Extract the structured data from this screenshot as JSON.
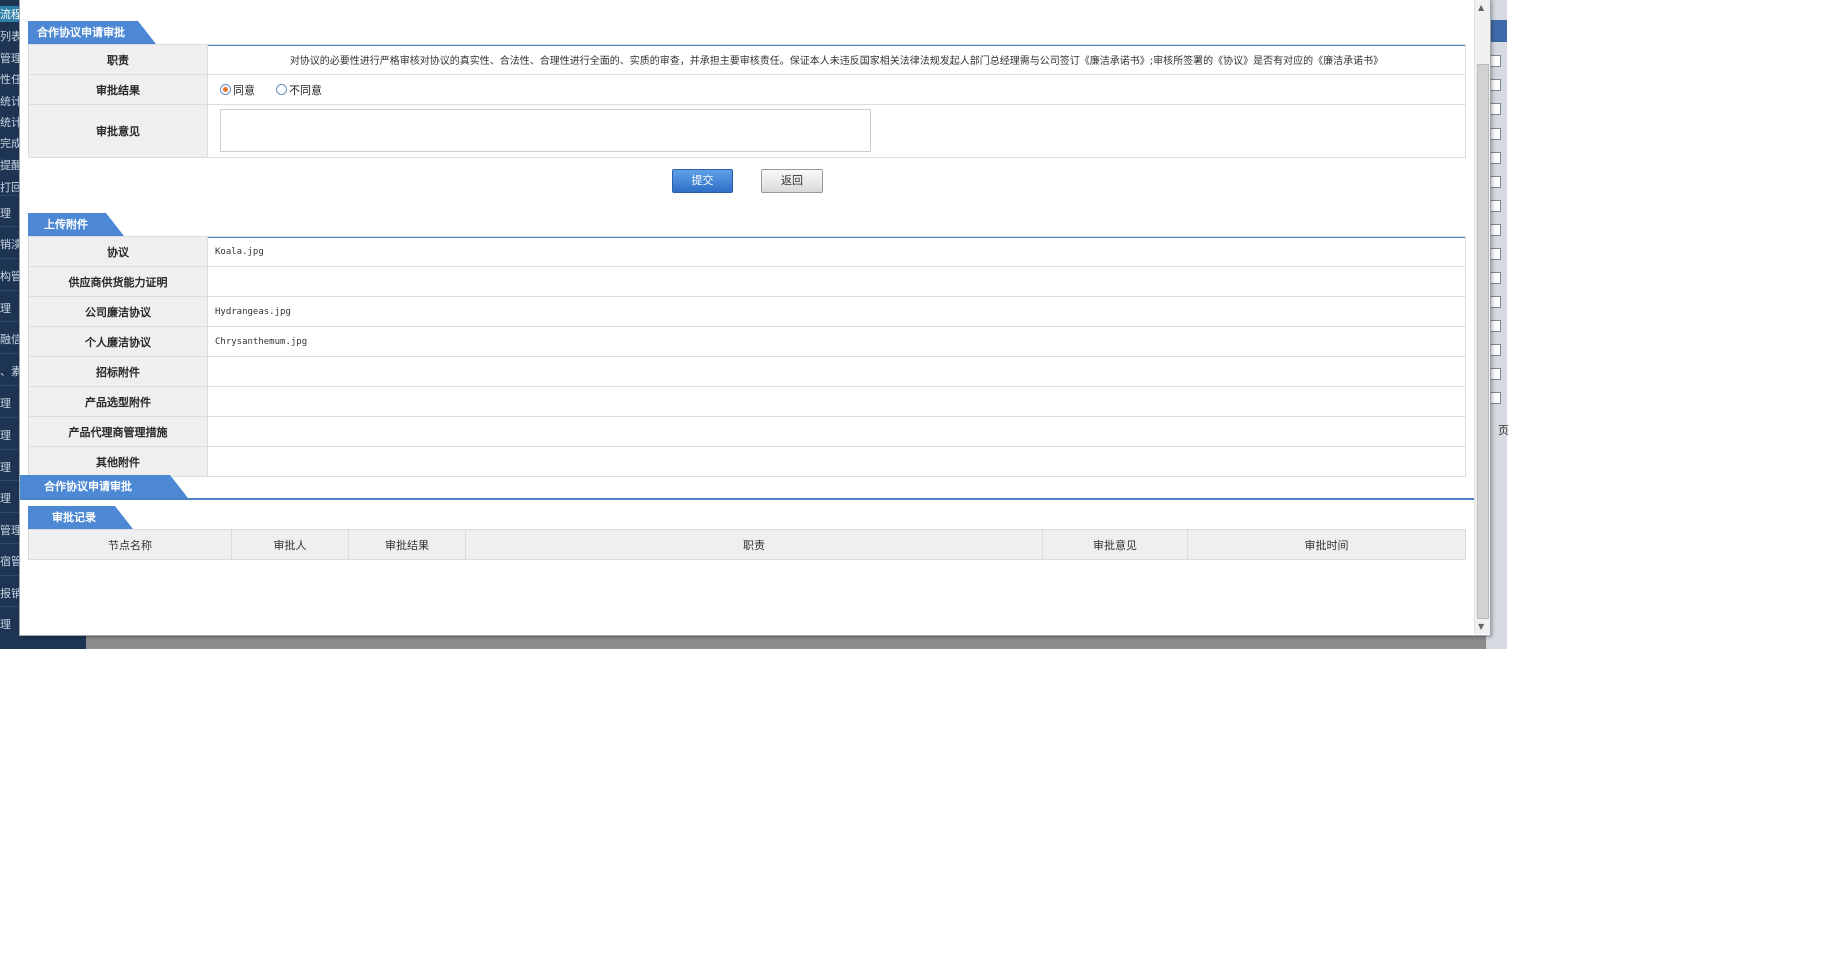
{
  "background": {
    "sidebar_items": [
      "流程",
      "列表",
      "管理",
      "性任",
      "统计",
      "统计",
      "完成",
      "提醒",
      "打回",
      "理",
      "销渎",
      "构管",
      "理",
      "融信",
      "、素",
      "理",
      "理",
      "理",
      "理",
      "管理",
      "宿管",
      "报销",
      "理"
    ],
    "right_glyph": "页"
  },
  "section_review": {
    "title": "合作协议申请审批",
    "duty_label": "职责",
    "duty_text": "对协议的必要性进行严格审核对协议的真实性、合法性、合理性进行全面的、实质的审查，并承担主要审核责任。保证本人未违反国家相关法律法规发起人部门总经理需与公司签订《廉洁承诺书》;审核所签署的《协议》是否有对应的《廉洁承诺书》",
    "result_label": "审批结果",
    "options": [
      "同意",
      "不同意"
    ],
    "selected_option": "同意",
    "opinion_label": "审批意见",
    "opinion_value": ""
  },
  "actions": {
    "submit": "提交",
    "back": "返回"
  },
  "section_attachments": {
    "title": "上传附件",
    "rows": [
      {
        "label": "协议",
        "value": "Koala.jpg"
      },
      {
        "label": "供应商供货能力证明",
        "value": ""
      },
      {
        "label": "公司廉洁协议",
        "value": "Hydrangeas.jpg"
      },
      {
        "label": "个人廉洁协议",
        "value": "Chrysanthemum.jpg"
      },
      {
        "label": "招标附件",
        "value": ""
      },
      {
        "label": "产品选型附件",
        "value": ""
      },
      {
        "label": "产品代理商管理措施",
        "value": ""
      },
      {
        "label": "其他附件",
        "value": ""
      }
    ]
  },
  "section_approval": {
    "title": "合作协议申请审批"
  },
  "section_records": {
    "title": "审批记录",
    "columns": [
      "节点名称",
      "审批人",
      "审批结果",
      "职责",
      "审批意见",
      "审批时间"
    ]
  }
}
